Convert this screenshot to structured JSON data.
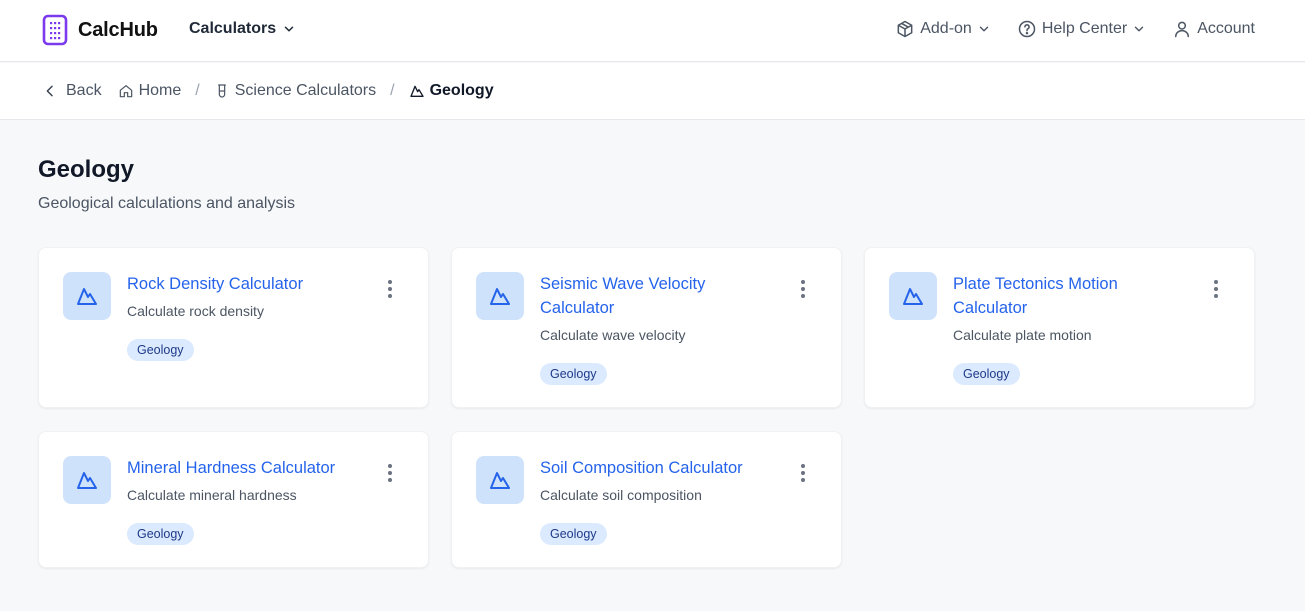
{
  "header": {
    "brand": "CalcHub",
    "calculators_menu": "Calculators",
    "nav": [
      {
        "label": "Add-on",
        "icon": "box-icon"
      },
      {
        "label": "Help Center",
        "icon": "help-circle-icon"
      },
      {
        "label": "Account",
        "icon": "user-icon"
      }
    ]
  },
  "breadcrumb": {
    "back": "Back",
    "home": "Home",
    "parent": "Science Calculators",
    "current": "Geology"
  },
  "page": {
    "title": "Geology",
    "subtitle": "Geological calculations and analysis"
  },
  "cards": [
    {
      "title": "Rock Density Calculator",
      "description": "Calculate rock density",
      "tag": "Geology"
    },
    {
      "title": "Seismic Wave Velocity Calculator",
      "description": "Calculate wave velocity",
      "tag": "Geology"
    },
    {
      "title": "Plate Tectonics Motion Calculator",
      "description": "Calculate plate motion",
      "tag": "Geology"
    },
    {
      "title": "Mineral Hardness Calculator",
      "description": "Calculate mineral hardness",
      "tag": "Geology"
    },
    {
      "title": "Soil Composition Calculator",
      "description": "Calculate soil composition",
      "tag": "Geology"
    }
  ],
  "colors": {
    "accent": "#2563eb",
    "brand": "#7c3aed",
    "tag_bg": "#dbeafe",
    "icon_bg": "#cfe2fb"
  }
}
